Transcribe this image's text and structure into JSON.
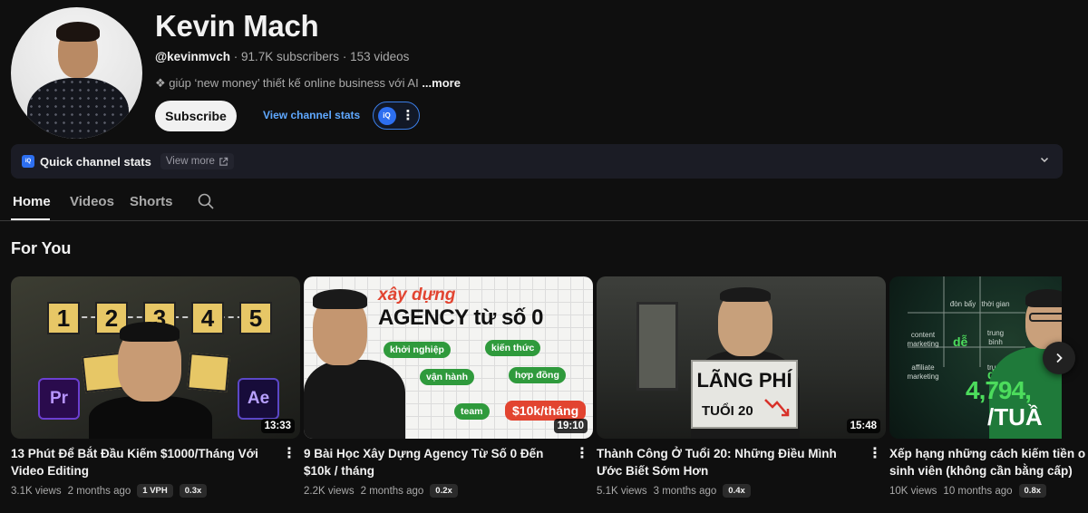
{
  "channel": {
    "name": "Kevin Mach",
    "handle": "@kevinmvch",
    "subscribers": "91.7K subscribers",
    "videos_count": "153 videos",
    "separator": "·",
    "description": "❖ giúp ‘new money’ thiết kế online business với AI",
    "more_label": "...more",
    "subscribe_label": "Subscribe",
    "stats_link_label": "View channel stats",
    "ext_logo_text": "iQ"
  },
  "quick_stats": {
    "title": "Quick channel stats",
    "view_more": "View more",
    "logo_text": "iQ"
  },
  "tabs": [
    {
      "label": "Home",
      "active": true
    },
    {
      "label": "Videos",
      "active": false
    },
    {
      "label": "Shorts",
      "active": false
    }
  ],
  "section": {
    "title": "For You"
  },
  "videos": [
    {
      "title": "13 Phút Để Bắt Đầu Kiếm $1000/Tháng Với Video Editing",
      "duration": "13:33",
      "views": "3.1K views",
      "age": "2 months ago",
      "badges": [
        "1 VPH",
        "0.3x"
      ],
      "thumb": {
        "numbers": [
          "1",
          "2",
          "3",
          "4",
          "5"
        ],
        "apps": [
          "Pr",
          "Ae"
        ]
      }
    },
    {
      "title": "9 Bài Học Xây Dựng Agency Từ Số 0 Đến $10k / tháng",
      "duration": "19:10",
      "views": "2.2K views",
      "age": "2 months ago",
      "badges": [
        "0.2x"
      ],
      "thumb": {
        "line1": "xây dựng",
        "line2": "AGENCY từ số 0",
        "tags": [
          "khởi nghiệp",
          "kiến thức",
          "vận hành",
          "hợp đồng",
          "team"
        ],
        "money": "$10k/tháng"
      }
    },
    {
      "title": "Thành Công Ở Tuổi 20: Những Điều Mình Ước Biết Sớm Hơn",
      "duration": "15:48",
      "views": "5.1K views",
      "age": "3 months ago",
      "badges": [
        "0.4x"
      ],
      "thumb": {
        "sign_line1": "LÃNG PHÍ",
        "sign_line2": "TUỔI 20"
      }
    },
    {
      "title": "Xếp hạng những cách kiếm tiền o sinh viên (không cần bằng cấp)",
      "duration": "",
      "views": "10K views",
      "age": "10 months ago",
      "badges": [
        "0.8x"
      ],
      "thumb": {
        "cells": [
          "đòn bẩy",
          "thời gian",
          "content marketing",
          "trung bình",
          "affiliate marketing",
          "trung"
        ],
        "de": "dễ",
        "big": "4,794,",
        "small": "/TUẦ"
      }
    }
  ],
  "colors": {
    "background": "#0f0f0f",
    "link": "#5fa8ff",
    "accent_blue": "#2d6ff0",
    "quick_stats_bg": "#1b1c25"
  }
}
